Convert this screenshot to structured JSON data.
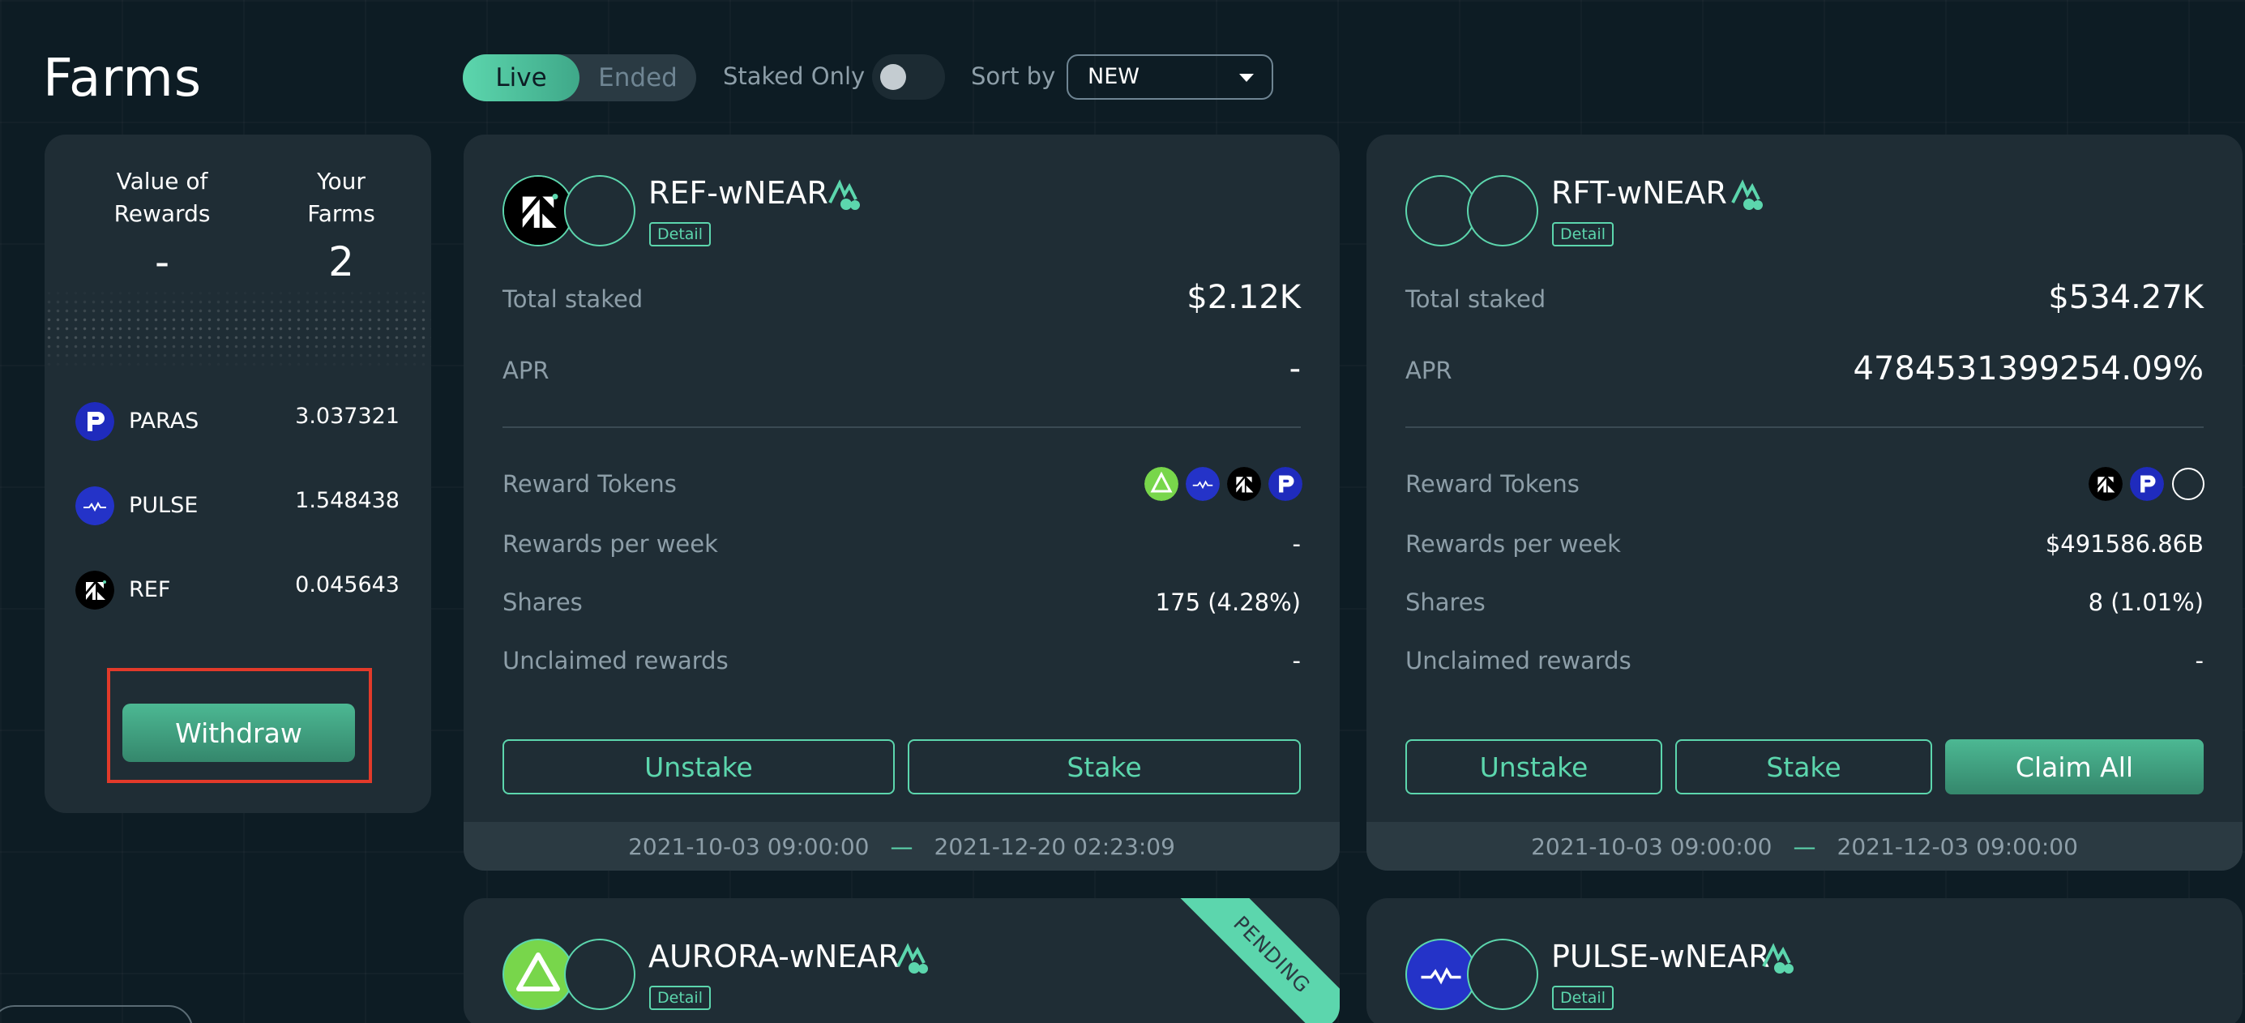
{
  "page": {
    "title": "Farms"
  },
  "filters": {
    "live_label": "Live",
    "ended_label": "Ended",
    "staked_only_label": "Staked Only",
    "staked_only_on": false,
    "sort_label": "Sort by",
    "sort_value": "NEW"
  },
  "rewards_panel": {
    "value_header": "Value of\nRewards",
    "value": "-",
    "farms_header": "Your\nFarms",
    "farms_count": "2",
    "tokens": [
      {
        "name": "PARAS",
        "amount": "3.037321",
        "icon": "paras-icon"
      },
      {
        "name": "PULSE",
        "amount": "1.548438",
        "icon": "pulse-icon"
      },
      {
        "name": "REF",
        "amount": "0.045643",
        "icon": "ref-icon"
      }
    ],
    "withdraw_label": "Withdraw"
  },
  "labels": {
    "total_staked": "Total staked",
    "apr": "APR",
    "reward_tokens": "Reward Tokens",
    "rewards_per_week": "Rewards per week",
    "shares": "Shares",
    "unclaimed_rewards": "Unclaimed rewards",
    "unstake": "Unstake",
    "stake": "Stake",
    "claim_all": "Claim All",
    "detail": "Detail",
    "dash": "—"
  },
  "farms": [
    {
      "pair": "REF-wNEAR",
      "total_staked": "$2.12K",
      "apr": "-",
      "reward_tokens": [
        "aurora-icon",
        "pulse-icon",
        "ref-icon",
        "paras-icon"
      ],
      "rewards_per_week": "-",
      "shares": "175 (4.28%)",
      "unclaimed": "-",
      "start": "2021-10-03 09:00:00",
      "end": "2021-12-20 02:23:09"
    },
    {
      "pair": "RFT-wNEAR",
      "total_staked": "$534.27K",
      "apr": "4784531399254.09%",
      "reward_tokens": [
        "ref-icon",
        "paras-icon",
        "unknown-token-icon"
      ],
      "rewards_per_week": "$491586.86B",
      "shares": "8 (1.01%)",
      "unclaimed": "-",
      "start": "2021-10-03 09:00:00",
      "end": "2021-12-03 09:00:00"
    },
    {
      "pair": "AURORA-wNEAR",
      "badge": "PENDING"
    },
    {
      "pair": "PULSE-wNEAR"
    }
  ],
  "colors": {
    "background": "#0d1c24",
    "card": "#1f2d35",
    "accent": "#5cd6ad",
    "highlight_box": "#e23a2a",
    "paras_blue": "#1f2bbd",
    "pulse_blue": "#2433c8",
    "aurora_green": "#78d64b"
  }
}
